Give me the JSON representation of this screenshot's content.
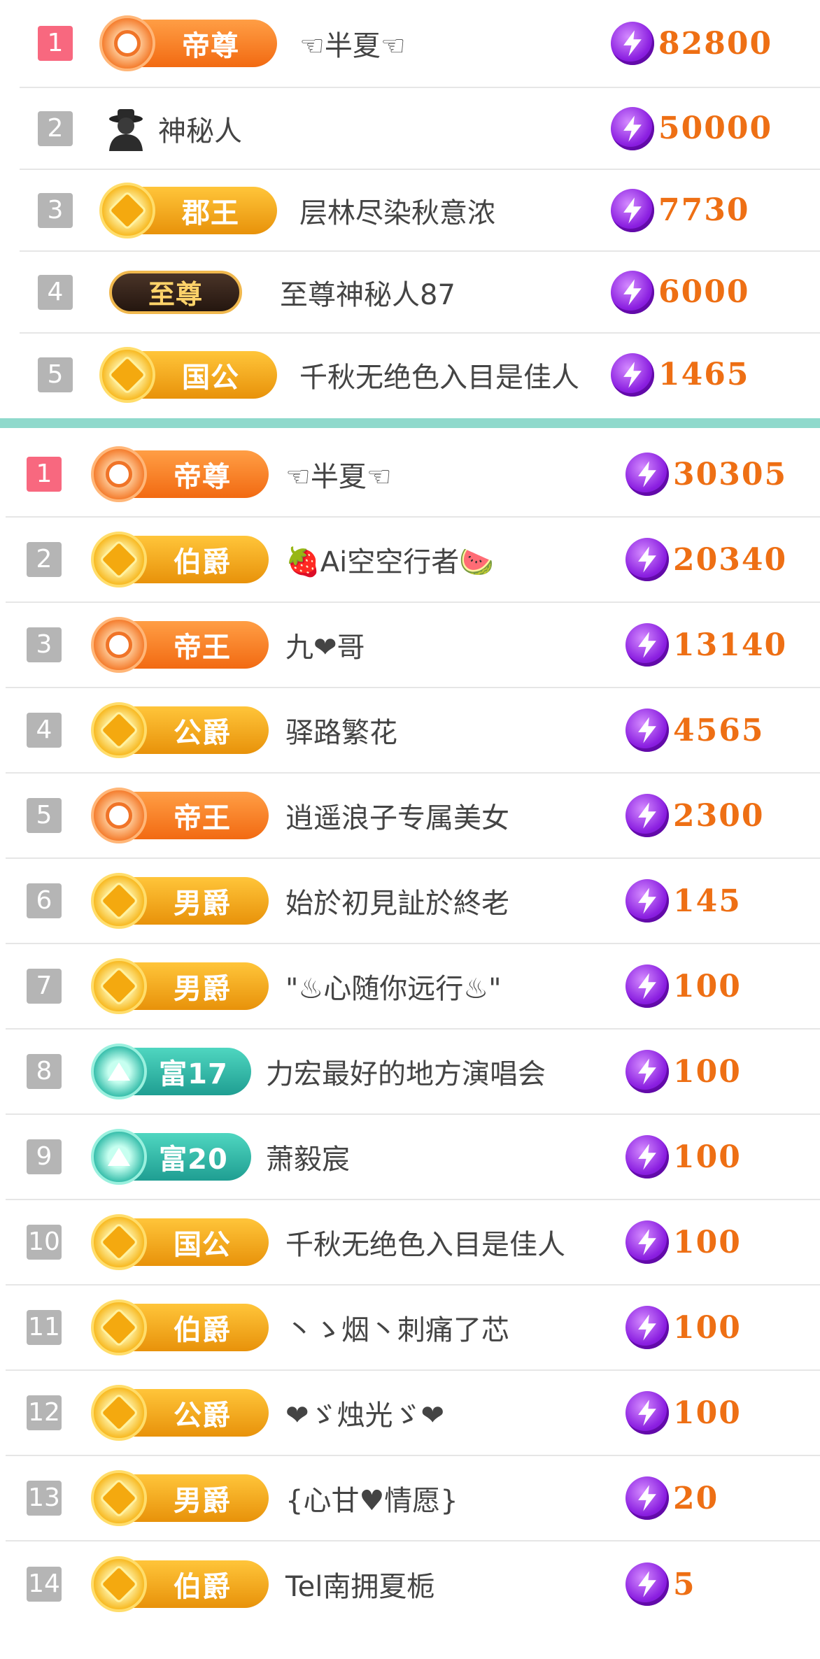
{
  "top_list": [
    {
      "rank": "1",
      "badge": {
        "label": "帝尊",
        "style": "orange"
      },
      "name": "☜半夏☜",
      "score": "82800"
    },
    {
      "rank": "2",
      "badge": null,
      "name": "神秘人",
      "score": "50000"
    },
    {
      "rank": "3",
      "badge": {
        "label": "郡王",
        "style": "gold"
      },
      "name": "层林尽染秋意浓",
      "score": "7730"
    },
    {
      "rank": "4",
      "badge": {
        "label": "至尊",
        "style": "dark"
      },
      "name": "至尊神秘人87",
      "score": "6000"
    },
    {
      "rank": "5",
      "badge": {
        "label": "国公",
        "style": "gold"
      },
      "name": "千秋无绝色入目是佳人",
      "score": "1465"
    }
  ],
  "bottom_list": [
    {
      "rank": "1",
      "badge": {
        "label": "帝尊",
        "style": "orange"
      },
      "name": "☜半夏☜",
      "score": "30305"
    },
    {
      "rank": "2",
      "badge": {
        "label": "伯爵",
        "style": "gold"
      },
      "name": "🍓Ai空空行者🍉",
      "score": "20340"
    },
    {
      "rank": "3",
      "badge": {
        "label": "帝王",
        "style": "orange"
      },
      "name": "九❤哥",
      "score": "13140"
    },
    {
      "rank": "4",
      "badge": {
        "label": "公爵",
        "style": "gold"
      },
      "name": "驿路繁花",
      "score": "4565"
    },
    {
      "rank": "5",
      "badge": {
        "label": "帝王",
        "style": "orange"
      },
      "name": "逍遥浪子专属美女",
      "score": "2300"
    },
    {
      "rank": "6",
      "badge": {
        "label": "男爵",
        "style": "gold"
      },
      "name": "始於初見訨於終老",
      "score": "145"
    },
    {
      "rank": "7",
      "badge": {
        "label": "男爵",
        "style": "gold"
      },
      "name": "\"♨心随你远行♨\"",
      "score": "100"
    },
    {
      "rank": "8",
      "badge": {
        "label": "富17",
        "style": "teal"
      },
      "name": "力宏最好的地方演唱会",
      "score": "100"
    },
    {
      "rank": "9",
      "badge": {
        "label": "富20",
        "style": "teal"
      },
      "name": "萧毅宸",
      "score": "100"
    },
    {
      "rank": "10",
      "badge": {
        "label": "国公",
        "style": "gold"
      },
      "name": "千秋无绝色入目是佳人",
      "score": "100"
    },
    {
      "rank": "11",
      "badge": {
        "label": "伯爵",
        "style": "gold"
      },
      "name": "丶ゝ烟丶刺痛了芯",
      "score": "100"
    },
    {
      "rank": "12",
      "badge": {
        "label": "公爵",
        "style": "gold"
      },
      "name": "❤ゞ烛光ゞ❤",
      "score": "100"
    },
    {
      "rank": "13",
      "badge": {
        "label": "男爵",
        "style": "gold"
      },
      "name": "{心甘♥情愿}",
      "score": "20"
    },
    {
      "rank": "14",
      "badge": {
        "label": "伯爵",
        "style": "gold"
      },
      "name": "Tel南拥夏栀",
      "score": "5"
    }
  ],
  "colors": {
    "accent_score": "#ee6f14",
    "rank_first": "#f8687f",
    "rank_other": "#b5b5b5",
    "divider": "#8fd9cc"
  },
  "icons": {
    "score": "lightning-coin-icon",
    "anonymous": "mystery-person-icon"
  }
}
